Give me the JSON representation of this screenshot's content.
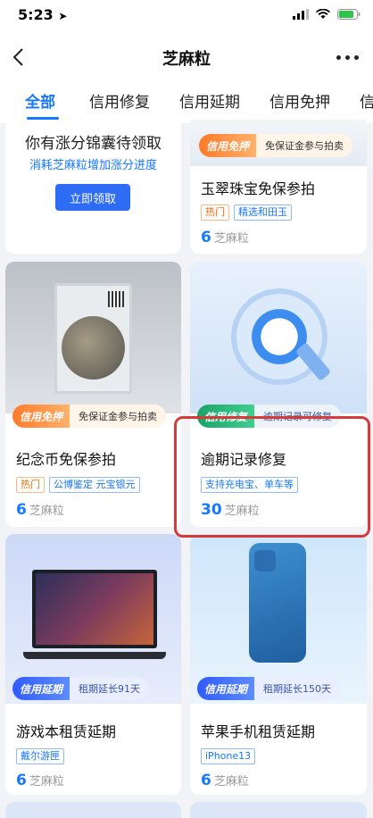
{
  "status_bar": {
    "time": "5:23"
  },
  "nav": {
    "title": "芝麻粒"
  },
  "tabs": [
    "全部",
    "信用修复",
    "信用延期",
    "信用免押",
    "信"
  ],
  "claim_card": {
    "title": "你有涨分锦囊待领取",
    "subtitle": "消耗芝麻粒增加涨分进度",
    "button": "立即领取"
  },
  "cards": [
    {
      "badge_main": "信用免押",
      "badge_sub": "免保证金参与拍卖",
      "title": "玉翠珠宝免保参拍",
      "tags": [
        "热门",
        "精选和田玉"
      ],
      "price_num": "6",
      "price_unit": "芝麻粒"
    },
    {
      "badge_main": "信用免押",
      "badge_sub": "免保证金参与拍卖",
      "title": "纪念币免保参拍",
      "tags": [
        "热门",
        "公博鉴定 元宝银元"
      ],
      "price_num": "6",
      "price_unit": "芝麻粒"
    },
    {
      "badge_main": "信用修复",
      "badge_sub": "逾期记录可修复",
      "title": "逾期记录修复",
      "tags": [
        "支持充电宝、单车等"
      ],
      "price_num": "30",
      "price_unit": "芝麻粒"
    },
    {
      "badge_main": "信用延期",
      "badge_sub": "租期延长91天",
      "title": "游戏本租赁延期",
      "tags": [
        "戴尔游匣"
      ],
      "price_num": "6",
      "price_unit": "芝麻粒"
    },
    {
      "badge_main": "信用延期",
      "badge_sub": "租期延长150天",
      "title": "苹果手机租赁延期",
      "tags": [
        "iPhone13"
      ],
      "price_num": "6",
      "price_unit": "芝麻粒"
    }
  ],
  "colors": {
    "accent": "#1677ff",
    "hot": "#ff6a00",
    "highlight": "#d63b3b"
  }
}
